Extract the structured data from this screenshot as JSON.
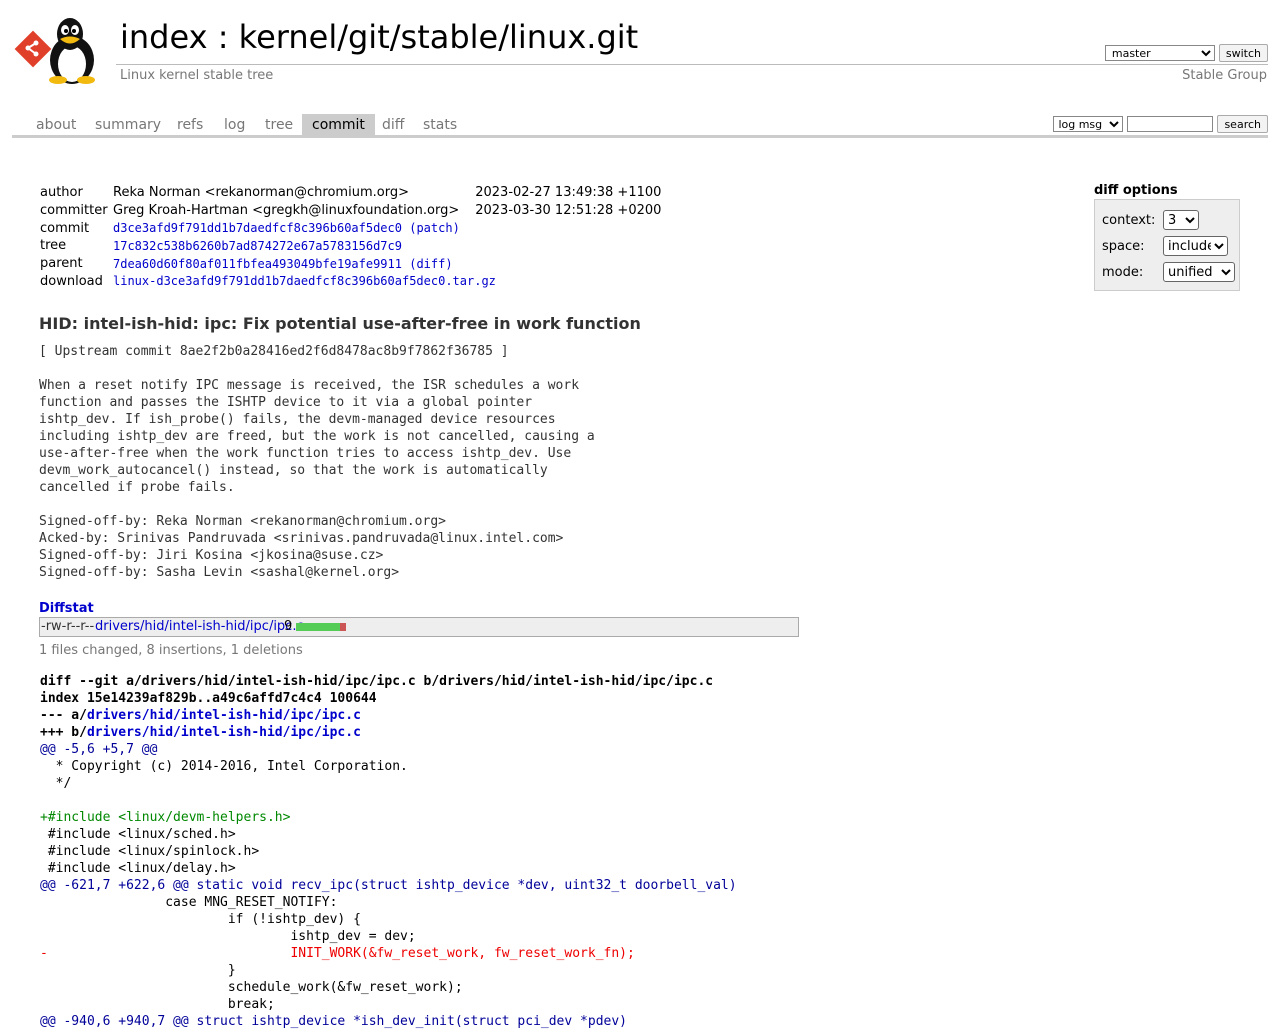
{
  "header": {
    "index_label": "index",
    "separator": ":",
    "repo_path": "kernel/git/stable/linux.git",
    "subtitle": "Linux kernel stable tree",
    "branch": "master",
    "switch_label": "switch",
    "group_link": "Stable Group"
  },
  "tabs": [
    {
      "label": "about"
    },
    {
      "label": "summary"
    },
    {
      "label": "refs"
    },
    {
      "label": "log"
    },
    {
      "label": "tree"
    },
    {
      "label": "commit"
    },
    {
      "label": "diff"
    },
    {
      "label": "stats"
    }
  ],
  "active_tab": "commit",
  "search": {
    "type": "log msg",
    "value": "",
    "button": "search"
  },
  "commit_info": {
    "author_label": "author",
    "author": "Reka Norman <rekanorman@chromium.org>",
    "author_date": "2023-02-27 13:49:38 +1100",
    "committer_label": "committer",
    "committer": "Greg Kroah-Hartman <gregkh@linuxfoundation.org>",
    "committer_date": "2023-03-30 12:51:28 +0200",
    "commit_label": "commit",
    "commit_sha": "d3ce3afd9f791dd1b7daedfcf8c396b60af5dec0",
    "patch_link": "(patch)",
    "tree_label": "tree",
    "tree_sha": "17c832c538b6260b7ad874272e67a5783156d7c9",
    "parent_label": "parent",
    "parent_sha": "7dea60d60f80af011fbfea493049bfe19afe9911",
    "diff_link": "(diff)",
    "download_label": "download",
    "download_file": "linux-d3ce3afd9f791dd1b7daedfcf8c396b60af5dec0.tar.gz"
  },
  "diff_options": {
    "title": "diff options",
    "context_label": "context:",
    "context_value": "3",
    "space_label": "space:",
    "space_value": "include",
    "mode_label": "mode:",
    "mode_value": "unified"
  },
  "commit_subject": "HID: intel-ish-hid: ipc: Fix potential use-after-free in work function",
  "commit_message": "[ Upstream commit 8ae2f2b0a28416ed2f6d8478ac8b9f7862f36785 ]\n\nWhen a reset notify IPC message is received, the ISR schedules a work\nfunction and passes the ISHTP device to it via a global pointer\nishtp_dev. If ish_probe() fails, the devm-managed device resources\nincluding ishtp_dev are freed, but the work is not cancelled, causing a\nuse-after-free when the work function tries to access ishtp_dev. Use\ndevm_work_autocancel() instead, so that the work is automatically\ncancelled if probe fails.\n\nSigned-off-by: Reka Norman <rekanorman@chromium.org>\nAcked-by: Srinivas Pandruvada <srinivas.pandruvada@linux.intel.com>\nSigned-off-by: Jiri Kosina <jkosina@suse.cz>\nSigned-off-by: Sasha Levin <sashal@kernel.org>",
  "diffstat": {
    "title": "Diffstat",
    "mode": "-rw-r--r--",
    "file": "drivers/hid/intel-ish-hid/ipc/ipc.c",
    "count": "9",
    "insertions": 8,
    "deletions": 1,
    "summary": "1 files changed, 8 insertions, 1 deletions"
  },
  "diff": {
    "git_line_prefix": "diff --git a/drivers/hid/intel-ish-hid/ipc/ipc.c b/drivers/hid/intel-ish-hid/ipc/ipc.c",
    "index_line": "index 15e14239af829b..a49c6affd7c4c4 100644",
    "minus_prefix": "--- a/",
    "plus_prefix": "+++ b/",
    "file_path": "drivers/hid/intel-ish-hid/ipc/ipc.c",
    "lines": [
      {
        "t": "hunk",
        "s": "@@ -5,6 +5,7 @@"
      },
      {
        "t": "ctx",
        "s": "  * Copyright (c) 2014-2016, Intel Corporation."
      },
      {
        "t": "ctx",
        "s": "  */"
      },
      {
        "t": "ctx",
        "s": ""
      },
      {
        "t": "add",
        "s": "+#include <linux/devm-helpers.h>"
      },
      {
        "t": "ctx",
        "s": " #include <linux/sched.h>"
      },
      {
        "t": "ctx",
        "s": " #include <linux/spinlock.h>"
      },
      {
        "t": "ctx",
        "s": " #include <linux/delay.h>"
      },
      {
        "t": "hunk",
        "s": "@@ -621,7 +622,6 @@ static void recv_ipc(struct ishtp_device *dev, uint32_t doorbell_val)"
      },
      {
        "t": "ctx",
        "s": " \t\tcase MNG_RESET_NOTIFY:"
      },
      {
        "t": "ctx",
        "s": " \t\t\tif (!ishtp_dev) {"
      },
      {
        "t": "ctx",
        "s": " \t\t\t\tishtp_dev = dev;"
      },
      {
        "t": "del",
        "s": "-\t\t\t\tINIT_WORK(&fw_reset_work, fw_reset_work_fn);"
      },
      {
        "t": "ctx",
        "s": " \t\t\t}"
      },
      {
        "t": "ctx",
        "s": " \t\t\tschedule_work(&fw_reset_work);"
      },
      {
        "t": "ctx",
        "s": " \t\t\tbreak;"
      },
      {
        "t": "hunk",
        "s": "@@ -940,6 +940,7 @@ struct ishtp_device *ish_dev_init(struct pci_dev *pdev)"
      }
    ]
  }
}
